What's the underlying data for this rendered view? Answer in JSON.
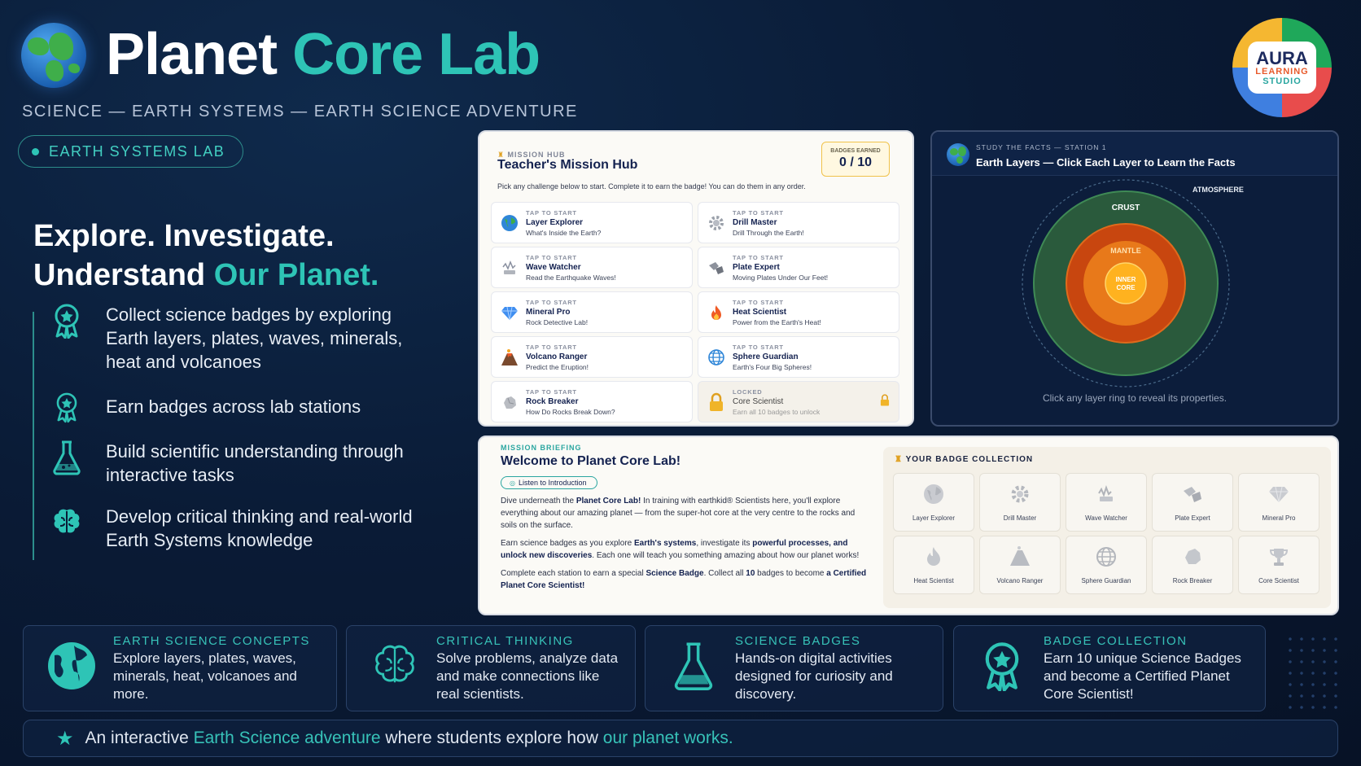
{
  "header": {
    "title_part1": "Planet",
    "title_part2": "Core Lab",
    "subtitle": "SCIENCE — EARTH SYSTEMS — EARTH SCIENCE ADVENTURE",
    "pill_label": "EARTH SYSTEMS LAB",
    "logo": {
      "line1": "AURA",
      "line2": "LEARNING",
      "line3": "STUDIO"
    }
  },
  "intro": {
    "line1": "Explore. Investigate.",
    "line2_a": "Understand",
    "line2_b": "Our Planet.",
    "features": [
      {
        "icon": "badge-icon",
        "text": "Collect science badges by exploring Earth layers, plates, waves, minerals, heat and volcanoes"
      },
      {
        "icon": "badge-icon",
        "text": "Earn badges across lab stations"
      },
      {
        "icon": "flask-icon",
        "text": "Build scientific understanding through interactive tasks"
      },
      {
        "icon": "brain-icon",
        "text": "Develop critical thinking and real-world Earth Systems knowledge"
      }
    ]
  },
  "hub": {
    "small": "MISSION HUB",
    "title": "Teacher's Mission Hub",
    "badges_label": "BADGES EARNED",
    "badges_value": "0 / 10",
    "description": "Pick any challenge below to start. Complete it to earn the badge! You can do them in any order.",
    "cards": [
      {
        "tag": "TAP TO START",
        "title": "Layer Explorer",
        "desc": "What's Inside the Earth?",
        "icon": "globe-icon"
      },
      {
        "tag": "TAP TO START",
        "title": "Drill Master",
        "desc": "Drill Through the Earth!",
        "icon": "gear-icon"
      },
      {
        "tag": "TAP TO START",
        "title": "Wave Watcher",
        "desc": "Read the Earthquake Waves!",
        "icon": "seismograph-icon"
      },
      {
        "tag": "TAP TO START",
        "title": "Plate Expert",
        "desc": "Moving Plates Under Our Feet!",
        "icon": "plates-icon"
      },
      {
        "tag": "TAP TO START",
        "title": "Mineral Pro",
        "desc": "Rock Detective Lab!",
        "icon": "gem-icon"
      },
      {
        "tag": "TAP TO START",
        "title": "Heat Scientist",
        "desc": "Power from the Earth's Heat!",
        "icon": "fire-icon"
      },
      {
        "tag": "TAP TO START",
        "title": "Volcano Ranger",
        "desc": "Predict the Eruption!",
        "icon": "volcano-icon"
      },
      {
        "tag": "TAP TO START",
        "title": "Sphere Guardian",
        "desc": "Earth's Four Big Spheres!",
        "icon": "sphere-icon"
      },
      {
        "tag": "TAP TO START",
        "title": "Rock Breaker",
        "desc": "How Do Rocks Break Down?",
        "icon": "rock-icon"
      },
      {
        "tag": "LOCKED",
        "title": "Core Scientist",
        "desc": "Earn all 10 badges to unlock",
        "icon": "lock-icon",
        "locked": true
      }
    ]
  },
  "facts": {
    "small": "STUDY THE FACTS — STATION 1",
    "title": "Earth Layers — Click Each Layer to Learn the Facts",
    "layers": {
      "atmosphere": "ATMOSPHERE",
      "crust": "CRUST",
      "mantle": "MANTLE",
      "inner1": "INNER",
      "inner2": "CORE"
    },
    "caption": "Click any layer ring to reveal its properties."
  },
  "briefing": {
    "small": "MISSION BRIEFING",
    "title": "Welcome to Planet Core Lab!",
    "listen": "Listen to Introduction",
    "p1": [
      {
        "t": "Dive underneath the "
      },
      {
        "t": "Planet Core Lab!",
        "b": true
      },
      {
        "t": " In training with earthkid® Scientists here, you'll explore everything about our amazing planet — from the super-hot core at the very centre to the rocks and soils on the surface."
      }
    ],
    "p2": [
      {
        "t": "Earn science badges as you explore "
      },
      {
        "t": "Earth's systems",
        "b": true
      },
      {
        "t": ", investigate its "
      },
      {
        "t": "powerful processes,",
        "b": true
      },
      {
        "t": " "
      },
      {
        "t": "and unlock new discoveries",
        "b": true
      },
      {
        "t": ". Each one will teach you something amazing about how our planet works!"
      }
    ],
    "p3": [
      {
        "t": "Complete each station to earn a special "
      },
      {
        "t": "Science Badge",
        "b": true
      },
      {
        "t": ". Collect all "
      },
      {
        "t": "10",
        "b": true
      },
      {
        "t": " badges to become "
      },
      {
        "t": "a Certified Planet Core Scientist!",
        "b": true
      }
    ],
    "collection_title": "YOUR BADGE COLLECTION",
    "badges": [
      {
        "name": "Layer Explorer",
        "icon": "globe-icon"
      },
      {
        "name": "Drill Master",
        "icon": "gear-icon"
      },
      {
        "name": "Wave Watcher",
        "icon": "seismograph-icon"
      },
      {
        "name": "Plate Expert",
        "icon": "plates-icon"
      },
      {
        "name": "Mineral Pro",
        "icon": "gem-icon"
      },
      {
        "name": "Heat Scientist",
        "icon": "fire-icon"
      },
      {
        "name": "Volcano Ranger",
        "icon": "volcano-icon"
      },
      {
        "name": "Sphere Guardian",
        "icon": "sphere-icon"
      },
      {
        "name": "Rock Breaker",
        "icon": "rock-icon"
      },
      {
        "name": "Core Scientist",
        "icon": "trophy-icon"
      }
    ]
  },
  "bottom_cards": [
    {
      "title": "EARTH SCIENCE CONCEPTS",
      "text": "Explore layers, plates, waves, minerals, heat, volcanoes and more.",
      "icon": "globe-icon"
    },
    {
      "title": "CRITICAL THINKING",
      "text": "Solve problems, analyze data and make connections like real scientists.",
      "icon": "brain-icon"
    },
    {
      "title": "SCIENCE BADGES",
      "text": "Hands-on digital activities designed for curiosity and discovery.",
      "icon": "flask-icon"
    },
    {
      "title": "BADGE COLLECTION",
      "text": "Earn 10 unique Science Badges and become a Certified Planet Core Scientist!",
      "icon": "badge-icon"
    }
  ],
  "footer": {
    "a": "An interactive",
    "b": "Earth Science adventure",
    "c": "where students explore how",
    "d": "our planet works."
  },
  "colors": {
    "accent": "#2ec4b6",
    "background": "#0a1b36",
    "badge_gold": "#f0c24b"
  }
}
